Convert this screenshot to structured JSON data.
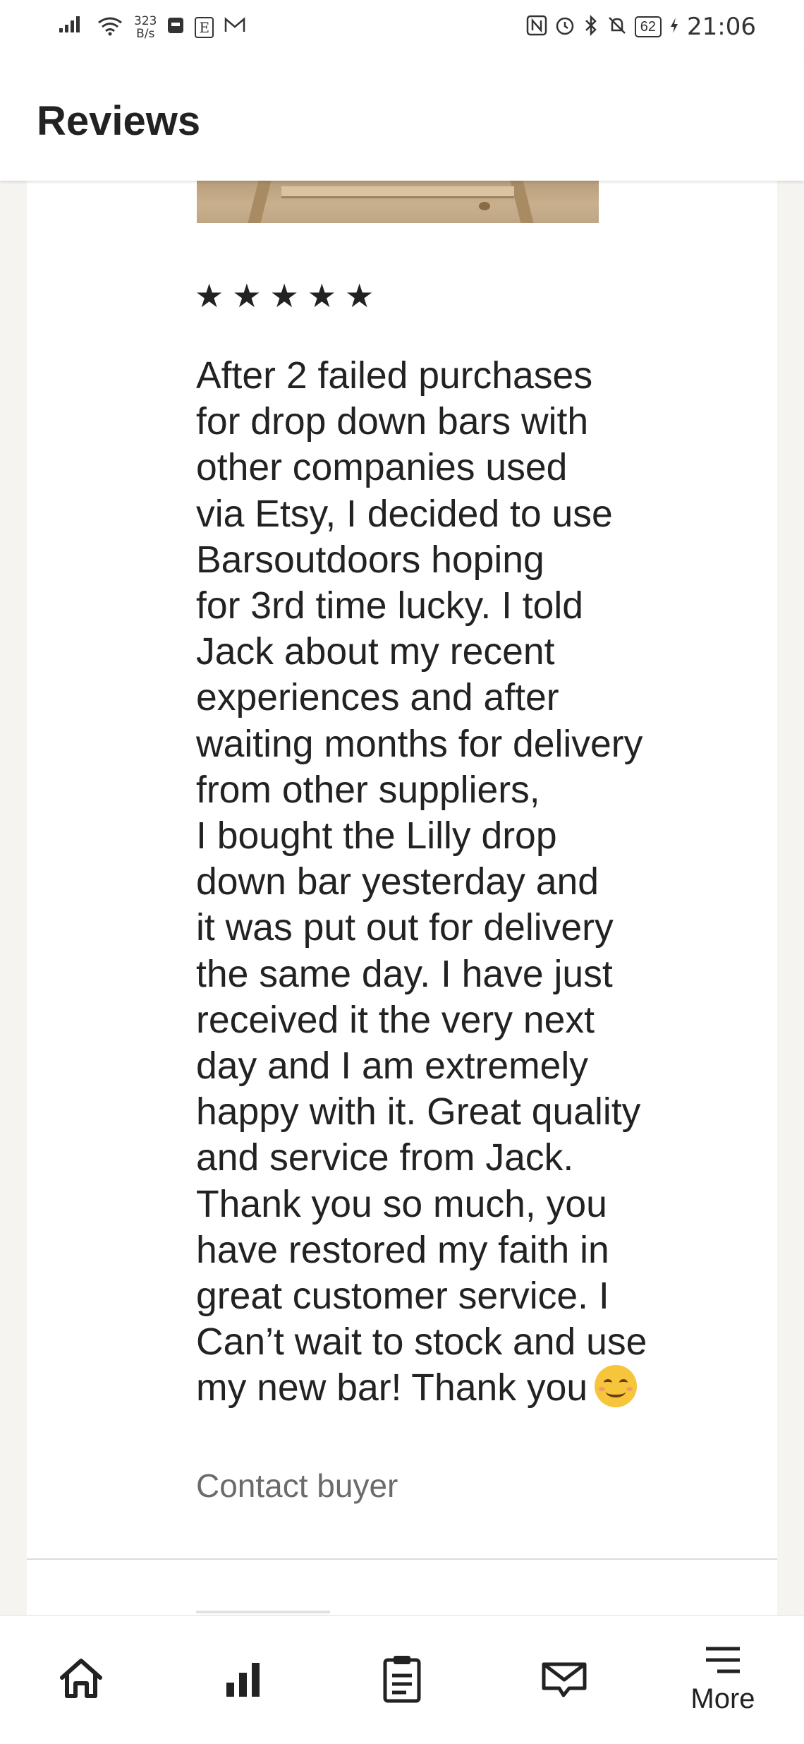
{
  "status_bar": {
    "net_speed_value": "323",
    "net_speed_unit": "B/s",
    "battery": "62",
    "time": "21:06",
    "indicator_box_label": "E",
    "icons": [
      "signal-icon",
      "wifi-icon",
      "notification-box-icon",
      "mail-icon",
      "nfc-icon",
      "alarm-icon",
      "bluetooth-icon",
      "mute-icon",
      "charging-icon"
    ]
  },
  "header": {
    "title": "Reviews"
  },
  "review": {
    "rating": 5,
    "stars": [
      "★",
      "★",
      "★",
      "★",
      "★"
    ],
    "text": "After 2 failed purchases\nfor drop down bars with\nother companies used\nvia Etsy, I decided to use\nBarsoutdoors hoping\nfor 3rd time lucky. I told\nJack about my recent\nexperiences and after\nwaiting months for delivery\nfrom other suppliers,\nI bought the Lilly drop\ndown bar yesterday and\nit was put out for delivery\nthe same day. I have just\nreceived it the very next\nday and I am extremely\nhappy with it. Great quality\nand service from Jack.\nThank you so much, you\nhave restored my faith in\ngreat customer service. I\nCan’t wait to stock and use\nmy new bar! Thank you",
    "emoji": "smiling-face-emoji",
    "contact_label": "Contact buyer"
  },
  "bottom_nav": {
    "items": [
      {
        "name": "home",
        "icon": "home-icon",
        "label": ""
      },
      {
        "name": "stats",
        "icon": "bar-chart-icon",
        "label": ""
      },
      {
        "name": "orders",
        "icon": "clipboard-icon",
        "label": ""
      },
      {
        "name": "messages",
        "icon": "envelope-icon",
        "label": ""
      },
      {
        "name": "more",
        "icon": "menu-icon",
        "label": "More"
      }
    ]
  },
  "colors": {
    "page_background": "#f5f4f1",
    "text_primary": "#222222",
    "text_secondary": "#6b6b6b",
    "emoji_yellow": "#f6c53b"
  }
}
